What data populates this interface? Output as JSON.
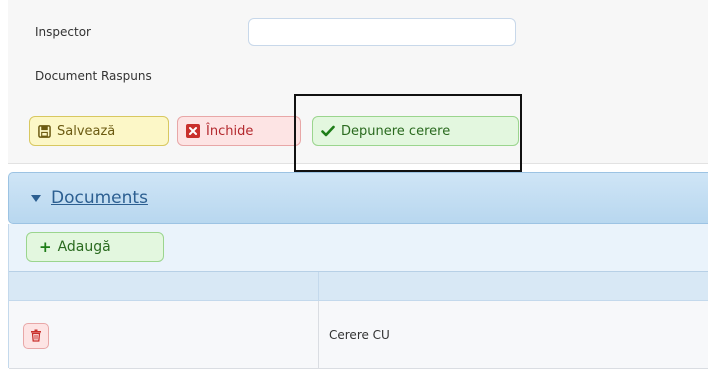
{
  "form": {
    "inspector_label": "Inspector",
    "inspector_value": "",
    "document_raspuns_label": "Document Raspuns"
  },
  "actions": {
    "save_label": "Salvează",
    "close_label": "Închide",
    "submit_label": "Depunere cerere"
  },
  "documents": {
    "title": "Documents",
    "add_label": "Adaugă",
    "rows": [
      {
        "name": "Cerere CU"
      }
    ]
  },
  "colors": {
    "save_bg": "#fcf7c7",
    "close_bg": "#fde4e4",
    "submit_bg": "#e3f7df",
    "panel_header": "#cfe5f6",
    "highlight_border": "#111111"
  },
  "icons": {
    "save": "floppy-disk-icon",
    "close": "close-square-icon",
    "submit": "checkmark-icon",
    "add": "plus-icon",
    "delete": "trash-icon",
    "collapse": "caret-down-icon"
  }
}
